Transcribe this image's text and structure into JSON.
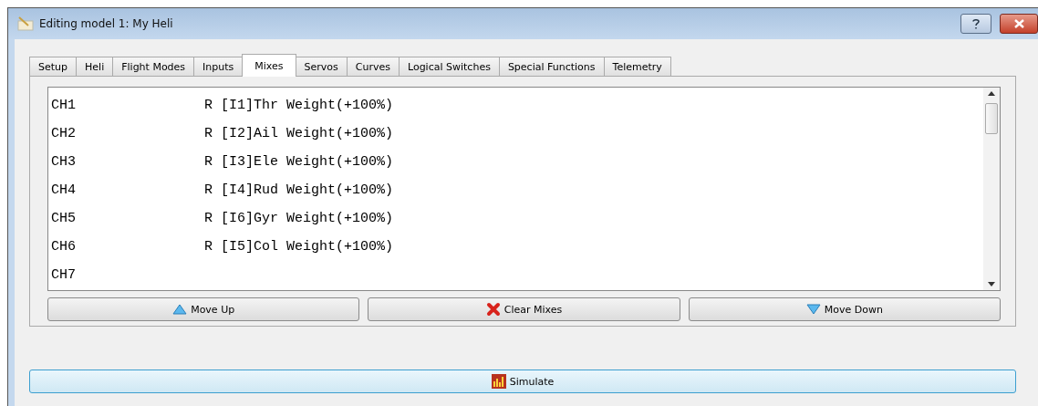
{
  "window": {
    "title": "Editing model 1: My Heli"
  },
  "tabs": [
    {
      "label": "Setup",
      "selected": false
    },
    {
      "label": "Heli",
      "selected": false
    },
    {
      "label": "Flight Modes",
      "selected": false
    },
    {
      "label": "Inputs",
      "selected": false
    },
    {
      "label": "Mixes",
      "selected": true
    },
    {
      "label": "Servos",
      "selected": false
    },
    {
      "label": "Curves",
      "selected": false
    },
    {
      "label": "Logical Switches",
      "selected": false
    },
    {
      "label": "Special Functions",
      "selected": false
    },
    {
      "label": "Telemetry",
      "selected": false
    }
  ],
  "mixes": [
    {
      "channel": "CH1",
      "mix": "R [I1]Thr Weight(+100%)"
    },
    {
      "channel": "CH2",
      "mix": "R [I2]Ail Weight(+100%)"
    },
    {
      "channel": "CH3",
      "mix": "R [I3]Ele Weight(+100%)"
    },
    {
      "channel": "CH4",
      "mix": "R [I4]Rud Weight(+100%)"
    },
    {
      "channel": "CH5",
      "mix": "R [I6]Gyr Weight(+100%)"
    },
    {
      "channel": "CH6",
      "mix": "R [I5]Col Weight(+100%)"
    },
    {
      "channel": "CH7"
    }
  ],
  "buttons": [
    {
      "label": "Move Up",
      "kind": "up"
    },
    {
      "label": "Clear Mixes",
      "kind": "clear"
    },
    {
      "label": "Move Down",
      "kind": "down"
    }
  ],
  "simulate": {
    "label": "Simulate"
  }
}
